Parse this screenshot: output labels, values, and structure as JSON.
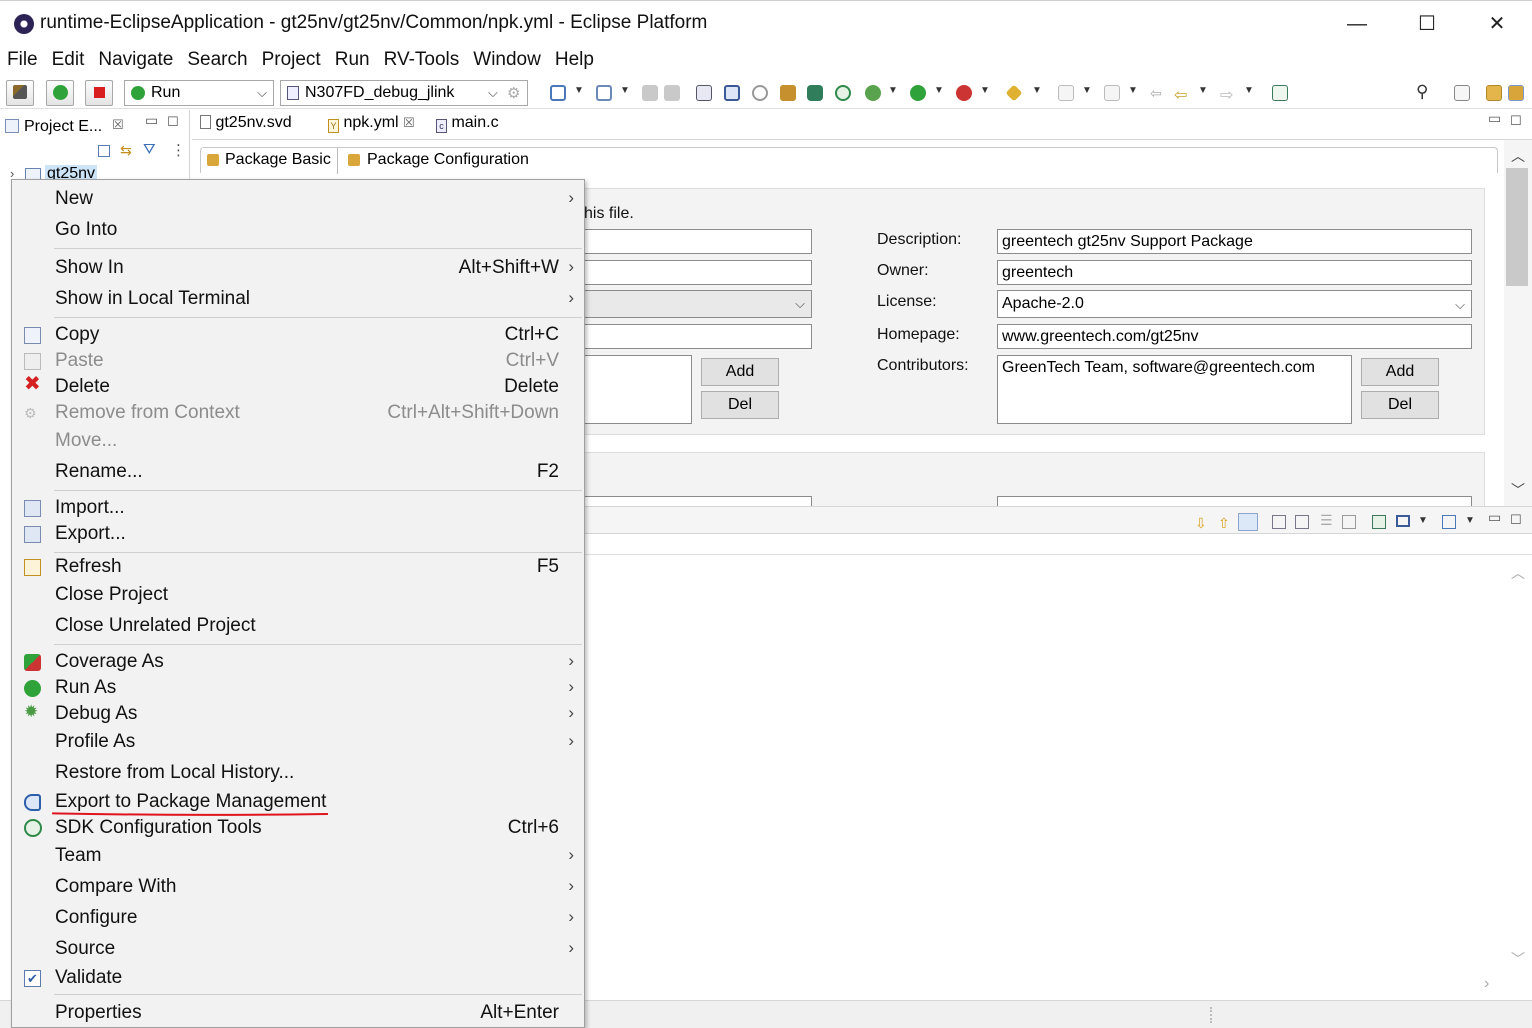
{
  "window": {
    "title": "runtime-EclipseApplication - gt25nv/gt25nv/Common/npk.yml - Eclipse Platform",
    "minimize_glyph": "—",
    "maximize_glyph": "☐",
    "close_glyph": "✕"
  },
  "menubar": [
    "File",
    "Edit",
    "Navigate",
    "Search",
    "Project",
    "Run",
    "RV-Tools",
    "Window",
    "Help"
  ],
  "toolbar": {
    "launch_mode": "Run",
    "launch_config": "N307FD_debug_jlink"
  },
  "left_panel": {
    "tab_label": "Project E...",
    "tree_root": "gt25nv"
  },
  "editor": {
    "tabs": [
      {
        "label": "gt25nv.svd",
        "icon": "file-icon"
      },
      {
        "label": "npk.yml",
        "icon": "yaml-icon",
        "dirty_close": "☒"
      },
      {
        "label": "main.c",
        "icon": "c-file-icon"
      }
    ],
    "subtabs": [
      "Package Basic",
      "Package Configuration"
    ],
    "hint_text": "his file.",
    "fields": {
      "description_label": "Description:",
      "description_value": "greentech gt25nv Support Package",
      "owner_label": "Owner:",
      "owner_value": "greentech",
      "license_label": "License:",
      "license_value": "Apache-2.0",
      "homepage_label": "Homepage:",
      "homepage_value": "www.greentech.com/gt25nv",
      "contributors_label": "Contributors:",
      "contributors_value": "GreenTech Team, software@greentech.com"
    },
    "buttons": {
      "add": "Add",
      "del": "Del"
    }
  },
  "context_menu": {
    "items": [
      {
        "label": "New",
        "shortcut": "",
        "submenu": true,
        "icon": "",
        "enabled": true
      },
      {
        "label": "Go Into",
        "shortcut": "",
        "submenu": false,
        "icon": "",
        "enabled": true
      },
      {
        "label": "Show In",
        "shortcut": "Alt+Shift+W",
        "submenu": true,
        "icon": "",
        "enabled": true
      },
      {
        "label": "Show in Local Terminal",
        "shortcut": "",
        "submenu": true,
        "icon": "",
        "enabled": true
      },
      {
        "label": "Copy",
        "shortcut": "Ctrl+C",
        "submenu": false,
        "icon": "copy-icon",
        "enabled": true
      },
      {
        "label": "Paste",
        "shortcut": "Ctrl+V",
        "submenu": false,
        "icon": "paste-icon",
        "enabled": false
      },
      {
        "label": "Delete",
        "shortcut": "Delete",
        "submenu": false,
        "icon": "delete-icon",
        "enabled": true
      },
      {
        "label": "Remove from Context",
        "shortcut": "Ctrl+Alt+Shift+Down",
        "submenu": false,
        "icon": "remove-context-icon",
        "enabled": false
      },
      {
        "label": "Move...",
        "shortcut": "",
        "submenu": false,
        "icon": "",
        "enabled": false
      },
      {
        "label": "Rename...",
        "shortcut": "F2",
        "submenu": false,
        "icon": "",
        "enabled": true
      },
      {
        "label": "Import...",
        "shortcut": "",
        "submenu": false,
        "icon": "import-icon",
        "enabled": true
      },
      {
        "label": "Export...",
        "shortcut": "",
        "submenu": false,
        "icon": "export-icon",
        "enabled": true
      },
      {
        "label": "Refresh",
        "shortcut": "F5",
        "submenu": false,
        "icon": "refresh-icon",
        "enabled": true
      },
      {
        "label": "Close Project",
        "shortcut": "",
        "submenu": false,
        "icon": "",
        "enabled": true
      },
      {
        "label": "Close Unrelated Project",
        "shortcut": "",
        "submenu": false,
        "icon": "",
        "enabled": true
      },
      {
        "label": "Coverage As",
        "shortcut": "",
        "submenu": true,
        "icon": "coverage-icon",
        "enabled": true
      },
      {
        "label": "Run As",
        "shortcut": "",
        "submenu": true,
        "icon": "run-icon",
        "enabled": true
      },
      {
        "label": "Debug As",
        "shortcut": "",
        "submenu": true,
        "icon": "debug-icon",
        "enabled": true
      },
      {
        "label": "Profile As",
        "shortcut": "",
        "submenu": true,
        "icon": "",
        "enabled": true
      },
      {
        "label": "Restore from Local History...",
        "shortcut": "",
        "submenu": false,
        "icon": "",
        "enabled": true
      },
      {
        "label": "Export to Package Management",
        "shortcut": "",
        "submenu": false,
        "icon": "export-package-icon",
        "enabled": true,
        "highlighted": true
      },
      {
        "label": "SDK Configuration Tools",
        "shortcut": "Ctrl+6",
        "submenu": false,
        "icon": "sdk-config-icon",
        "enabled": true
      },
      {
        "label": "Team",
        "shortcut": "",
        "submenu": true,
        "icon": "",
        "enabled": true
      },
      {
        "label": "Compare With",
        "shortcut": "",
        "submenu": true,
        "icon": "",
        "enabled": true
      },
      {
        "label": "Configure",
        "shortcut": "",
        "submenu": true,
        "icon": "",
        "enabled": true
      },
      {
        "label": "Source",
        "shortcut": "",
        "submenu": true,
        "icon": "",
        "enabled": true
      },
      {
        "label": "Validate",
        "shortcut": "",
        "submenu": false,
        "icon": "checkbox-checked-icon",
        "enabled": true
      },
      {
        "label": "Properties",
        "shortcut": "Alt+Enter",
        "submenu": false,
        "icon": "",
        "enabled": true
      }
    ],
    "submenu_glyph": "›"
  },
  "colors": {
    "annotation_underline": "#e0141e",
    "menu_background": "#f2f2f2",
    "section_background": "#f3f3f3"
  }
}
